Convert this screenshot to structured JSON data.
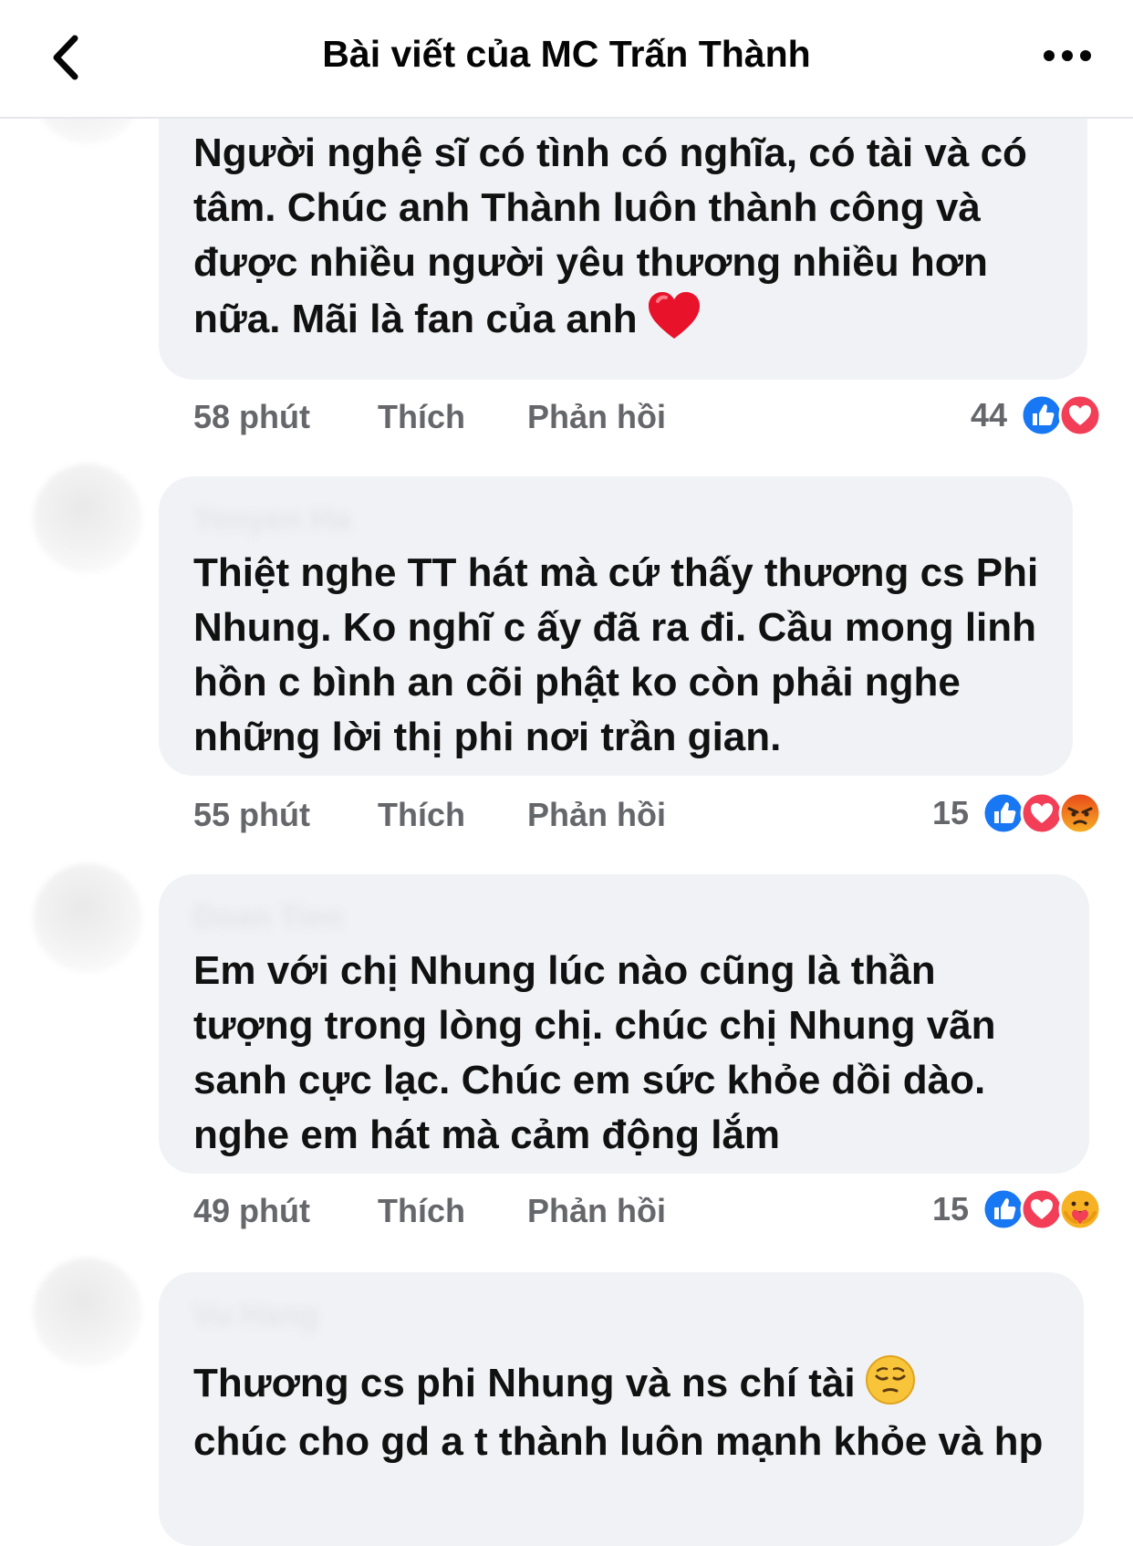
{
  "header": {
    "title": "Bài viết của MC Trấn Thành",
    "back_icon": "chevron-left-icon",
    "more_icon": "more-horizontal-icon"
  },
  "colors": {
    "bubble_bg": "#f0f2f5",
    "meta_text": "#65676b",
    "like_blue": "#1877f2",
    "love_red": "#f33e58",
    "angry_orange": "#f7713c",
    "care_yellow": "#f7b125"
  },
  "comments": [
    {
      "text": "Người nghệ sĩ có tình có nghĩa, có tài và có tâm. Chúc anh Thành luôn thành công và được nhiều người yêu thương nhiều hơn nữa. Mãi là fan của anh",
      "emoji": "red-heart-emoji",
      "time": "58 phút",
      "like_label": "Thích",
      "reply_label": "Phản hồi",
      "reaction_count": "44",
      "reactions": [
        "like",
        "love"
      ]
    },
    {
      "text": "Thiệt nghe TT  hát mà cứ thấy thương cs Phi Nhung. Ko nghĩ c ấy đã ra đi. Cầu mong linh hồn c bình an cõi phật ko còn phải nghe những lời thị phi nơi trần gian.",
      "time": "55 phút",
      "like_label": "Thích",
      "reply_label": "Phản hồi",
      "reaction_count": "15",
      "reactions": [
        "like",
        "love",
        "angry"
      ]
    },
    {
      "text": "Em với chị Nhung lúc nào cũng là thần tượng trong lòng chị. chúc chị Nhung vãn sanh cực lạc. Chúc em sức khỏe dồi dào. nghe em hát mà cảm động lắm",
      "time": "49 phút",
      "like_label": "Thích",
      "reply_label": "Phản hồi",
      "reaction_count": "15",
      "reactions": [
        "like",
        "love",
        "care"
      ]
    },
    {
      "text": "Thương cs phi Nhung và ns chí tài",
      "text_cont": "chúc cho gd a t thành luôn mạnh khỏe và hp",
      "emoji": "pensive-face-emoji"
    }
  ]
}
